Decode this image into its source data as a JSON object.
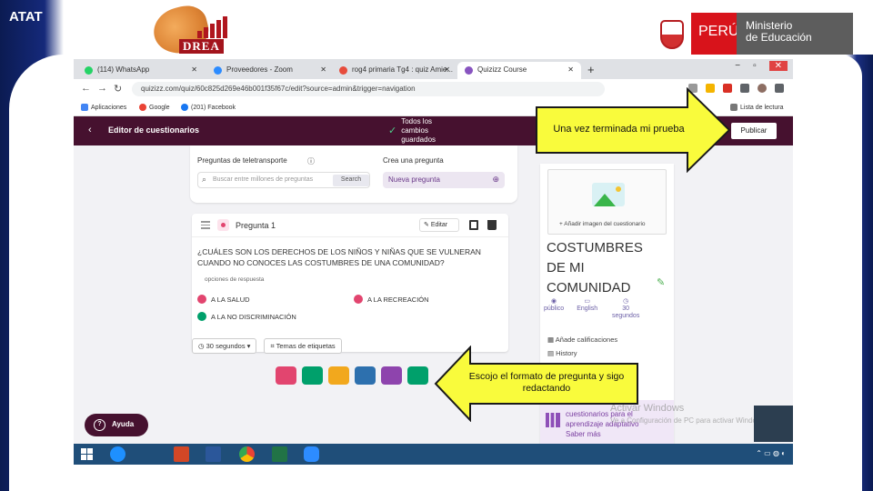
{
  "slide": {
    "corner_label": "ATAT",
    "logo_left_text": "DREA",
    "logo_right": {
      "country": "PERÚ",
      "ministry_line1": "Ministerio",
      "ministry_line2": "de Educación"
    }
  },
  "browser": {
    "tabs": [
      {
        "label": "(114) WhatsApp",
        "icon": "whatsapp-icon",
        "color": "#25d366"
      },
      {
        "label": "Proveedores - Zoom",
        "icon": "zoom-icon",
        "color": "#2d8cff"
      },
      {
        "label": "rog4 primaria Tg4 : quiz Amie...",
        "icon": "grid-icon",
        "color": "#e74c3c"
      },
      {
        "label": "Quizizz Course",
        "icon": "quizizz-icon",
        "color": "#8854c0"
      }
    ],
    "new_tab": "+",
    "url": "quizizz.com/quiz/60c825d269e46b001f35f67c/edit?source=admin&trigger=navigation",
    "bookmarks": [
      "Aplicaciones",
      "Google",
      "(201) Facebook"
    ],
    "reading_list": "Lista de lectura"
  },
  "quiz_editor": {
    "header_title": "Editor de cuestionarios",
    "saved_status": [
      "Todos los",
      "cambios",
      "guardados"
    ],
    "publish_label": "Publicar",
    "teleport_label": "Preguntas de teletransporte",
    "search_placeholder": "Buscar entre millones de preguntas",
    "search_button": "Search",
    "create_label": "Crea una pregunta",
    "new_question_button": "Nueva pregunta",
    "question": {
      "number_label": "Pregunta 1",
      "edit_label": "Editar",
      "text": "¿CUÁLES SON LOS DERECHOS DE LOS NIÑOS Y NIÑAS QUE SE VULNERAN CUANDO NO CONOCES LAS COSTUMBRES DE UNA COMUNIDAD?",
      "options_header": "opciones de respuesta",
      "options": [
        {
          "label": "A LA SALUD",
          "correct": false
        },
        {
          "label": "A LA RECREACIÓN",
          "correct": false
        },
        {
          "label": "A LA NO DISCRIMINACIÓN",
          "correct": true
        }
      ]
    },
    "time_chip": "30 segundos",
    "tags_chip": "Temas de etiquetas",
    "help_label": "Ayuda",
    "side": {
      "add_image": "Añadir imagen del cuestionario",
      "title_lines": [
        "COSTUMBRES",
        "DE MI",
        "COMUNIDAD"
      ],
      "meta": [
        {
          "label": "público",
          "icon": "eye-icon"
        },
        {
          "label": "English",
          "icon": "language-icon"
        },
        {
          "label": "30 segundos",
          "icon": "clock-icon"
        }
      ],
      "links": [
        "Añade calificaciones",
        "History"
      ],
      "promo_lines": [
        "cuestionarios para el",
        "aprendizaje adaptativo",
        "Saber más"
      ]
    }
  },
  "os": {
    "watermark_line1": "Activar Windows",
    "watermark_line2": "Ve a Configuración de PC para activar Windows.",
    "taskbar_apps": [
      {
        "icon": "ie-icon",
        "color": "#1e90ff"
      },
      {
        "icon": "powerpoint-icon",
        "color": "#d24726"
      },
      {
        "icon": "word-icon",
        "color": "#2b579a"
      },
      {
        "icon": "chrome-icon",
        "color": "#fbbc05"
      },
      {
        "icon": "excel-icon",
        "color": "#217346"
      },
      {
        "icon": "zoom-icon",
        "color": "#2d8cff"
      }
    ]
  },
  "annotations": {
    "callout_publish": "Una vez terminada mi prueba",
    "callout_format": "Escojo el formato de pregunta y sigo redactando",
    "callout_color": "#f9fb3c"
  },
  "tool_buttons": [
    {
      "icon": "multiple-choice-icon",
      "color": "#e2456f"
    },
    {
      "icon": "checkbox-icon",
      "color": "#00a06b"
    },
    {
      "icon": "fill-blank-icon",
      "color": "#f2a81d"
    },
    {
      "icon": "poll-icon",
      "color": "#2d70ae"
    },
    {
      "icon": "open-ended-icon",
      "color": "#8e44ad"
    },
    {
      "icon": "slide-icon",
      "color": "#00a06b"
    }
  ]
}
